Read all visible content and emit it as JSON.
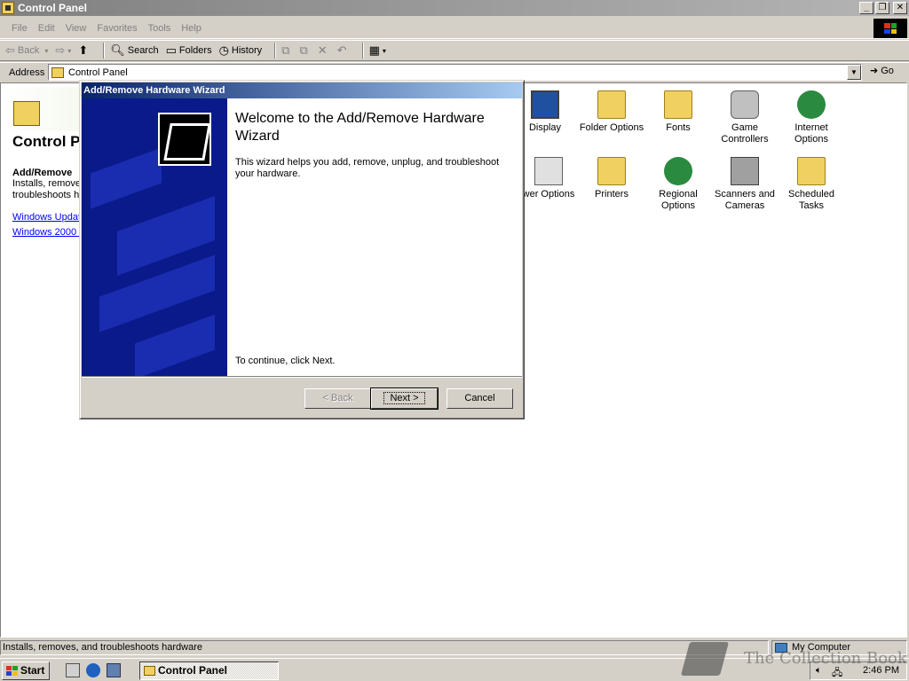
{
  "window": {
    "title": "Control Panel",
    "min": "_",
    "restore": "❐",
    "close": "✕"
  },
  "menu": [
    "File",
    "Edit",
    "View",
    "Favorites",
    "Tools",
    "Help"
  ],
  "toolbar": {
    "back": "Back",
    "forward": "",
    "up": "",
    "search": "Search",
    "folders": "Folders",
    "history": "History"
  },
  "address": {
    "label": "Address",
    "value": "Control Panel",
    "go": "Go"
  },
  "leftpane": {
    "title": "Control P",
    "item_title": "Add/Remove",
    "item_desc_1": "Installs, remove",
    "item_desc_2": "troubleshoots h",
    "link1": "Windows Updat",
    "link2": "Windows 2000 :"
  },
  "icons": [
    {
      "label": "Display"
    },
    {
      "label": "Folder Options"
    },
    {
      "label": "Fonts"
    },
    {
      "label": "Game Controllers"
    },
    {
      "label": "Internet Options"
    },
    {
      "label": "wer Options"
    },
    {
      "label": "Printers"
    },
    {
      "label": "Regional Options"
    },
    {
      "label": "Scanners and Cameras"
    },
    {
      "label": "Scheduled Tasks"
    }
  ],
  "dialog": {
    "title": "Add/Remove Hardware Wizard",
    "heading": "Welcome to the Add/Remove Hardware Wizard",
    "body": "This wizard helps you add, remove, unplug, and troubleshoot your hardware.",
    "continue": "To continue, click Next.",
    "back": "< Back",
    "next": "Next >",
    "cancel": "Cancel"
  },
  "status": {
    "text": "Installs, removes, and troubleshoots hardware",
    "zone": "My Computer"
  },
  "taskbar": {
    "start": "Start",
    "task": "Control Panel",
    "clock": "2:46 PM"
  },
  "watermark": "The Collection Book"
}
